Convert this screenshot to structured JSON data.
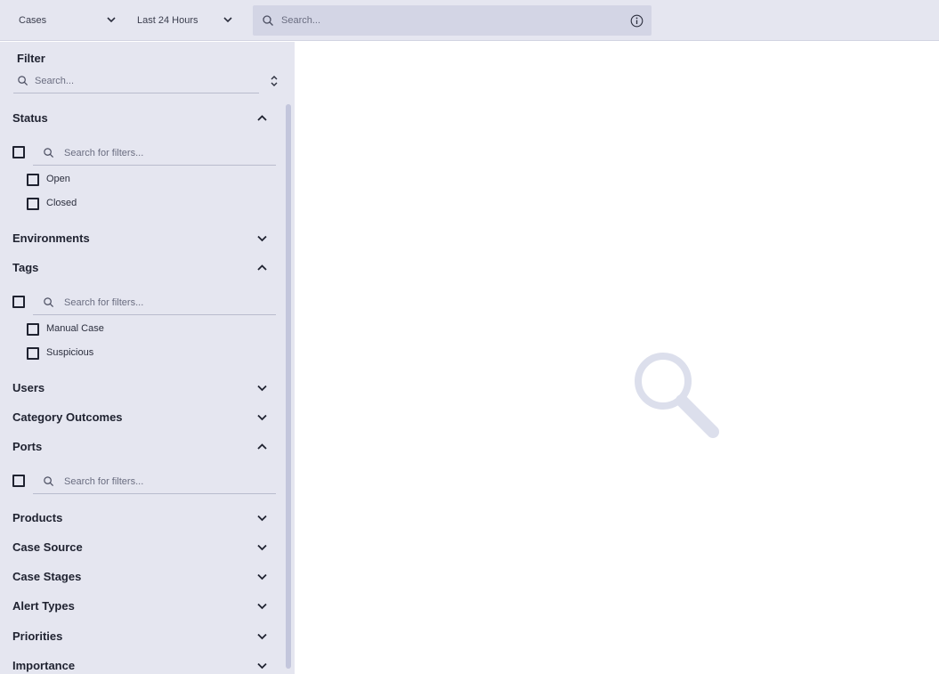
{
  "topbar": {
    "entity_select": "Cases",
    "time_select": "Last 24 Hours",
    "search_placeholder": "Search..."
  },
  "sidebar": {
    "title": "Filter",
    "search_placeholder": "Search...",
    "filter_search_placeholder": "Search for filters...",
    "sections": {
      "status": {
        "label": "Status",
        "expanded": true,
        "options": [
          "Open",
          "Closed"
        ]
      },
      "environments": {
        "label": "Environments",
        "expanded": false
      },
      "tags": {
        "label": "Tags",
        "expanded": true,
        "options": [
          "Manual Case",
          "Suspicious"
        ]
      },
      "users": {
        "label": "Users",
        "expanded": false
      },
      "category_outcomes": {
        "label": "Category Outcomes",
        "expanded": false
      },
      "ports": {
        "label": "Ports",
        "expanded": true,
        "options": []
      },
      "products": {
        "label": "Products",
        "expanded": false
      },
      "case_source": {
        "label": "Case Source",
        "expanded": false
      },
      "case_stages": {
        "label": "Case Stages",
        "expanded": false
      },
      "alert_types": {
        "label": "Alert Types",
        "expanded": false
      },
      "priorities": {
        "label": "Priorities",
        "expanded": false
      },
      "importance": {
        "label": "Importance",
        "expanded": false
      }
    }
  },
  "icons": {
    "search": "search-icon",
    "chevron_down": "chevron-down-icon",
    "chevron_up": "chevron-up-icon",
    "info": "info-icon",
    "sort": "sort-icon",
    "empty_state": "magnifier-icon"
  },
  "colors": {
    "sidebar_bg": "#e5e6f0",
    "search_bg": "#d3d5e5",
    "empty_icon": "#dcdfec"
  }
}
